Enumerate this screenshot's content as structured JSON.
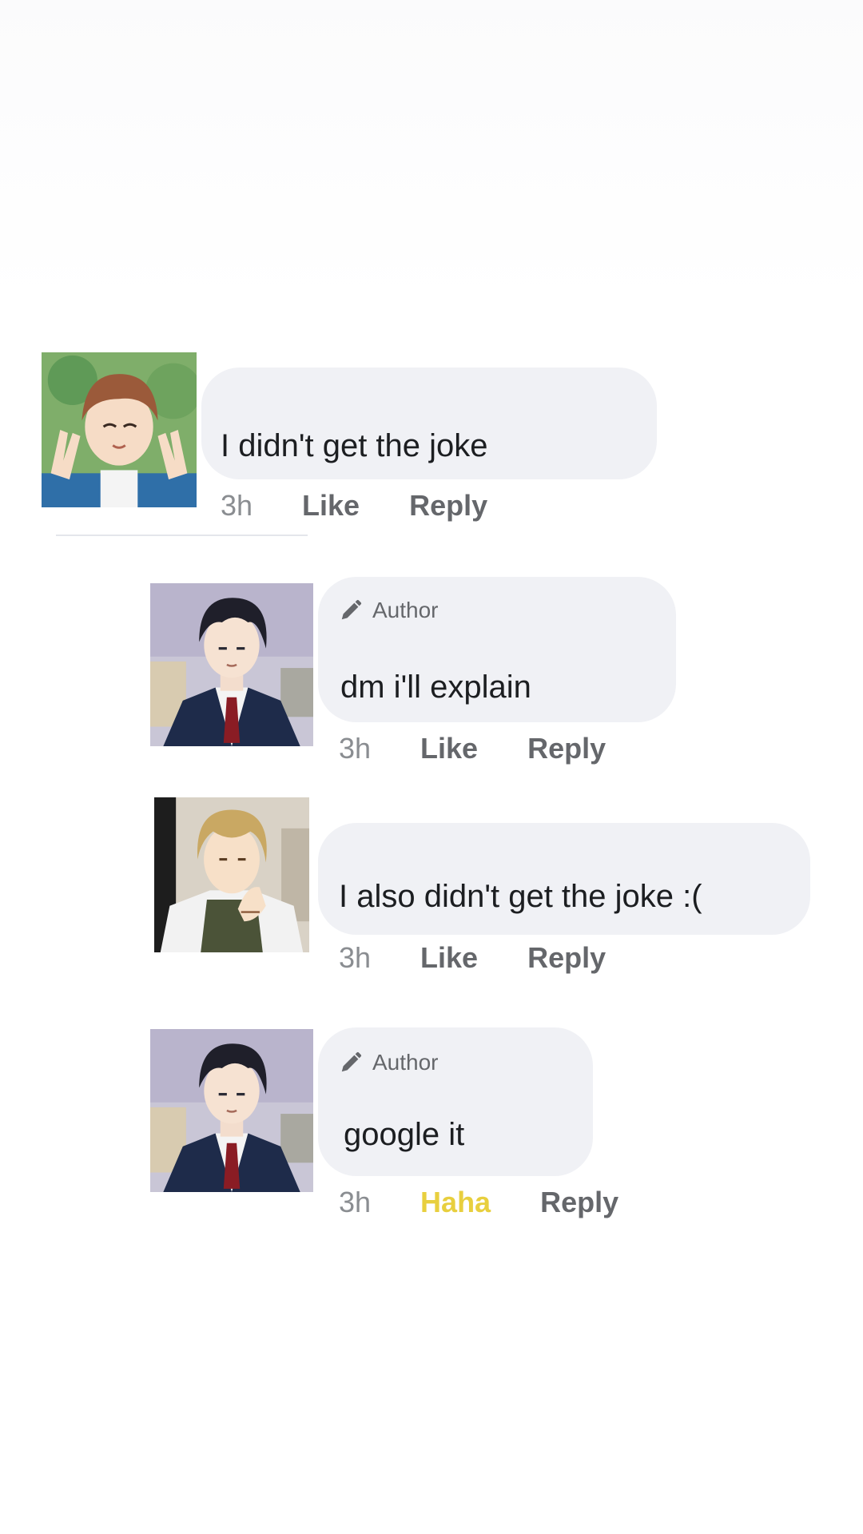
{
  "comments": [
    {
      "avatar_icon": "avatar-brown-hair-peace-sign",
      "text": "I didn't get the joke",
      "time": "3h",
      "like": "Like",
      "reply": "Reply"
    },
    {
      "avatar_icon": "avatar-dark-hair-blazer",
      "badge": "Author",
      "badge_icon": "pencil-icon",
      "text": "dm i'll explain",
      "time": "3h",
      "like": "Like",
      "reply": "Reply"
    },
    {
      "avatar_icon": "avatar-blond-hair-hand-on-chin",
      "text": "I also didn't get the joke :(",
      "time": "3h",
      "like": "Like",
      "reply": "Reply"
    },
    {
      "avatar_icon": "avatar-dark-hair-blazer",
      "badge": "Author",
      "badge_icon": "pencil-icon",
      "text": "google it",
      "time": "3h",
      "like": "Haha",
      "reply": "Reply",
      "reaction_color": "#e8cf3e"
    }
  ],
  "colors": {
    "bubble": "#f0f1f5",
    "text": "#1c1e21",
    "meta": "#65676b"
  }
}
